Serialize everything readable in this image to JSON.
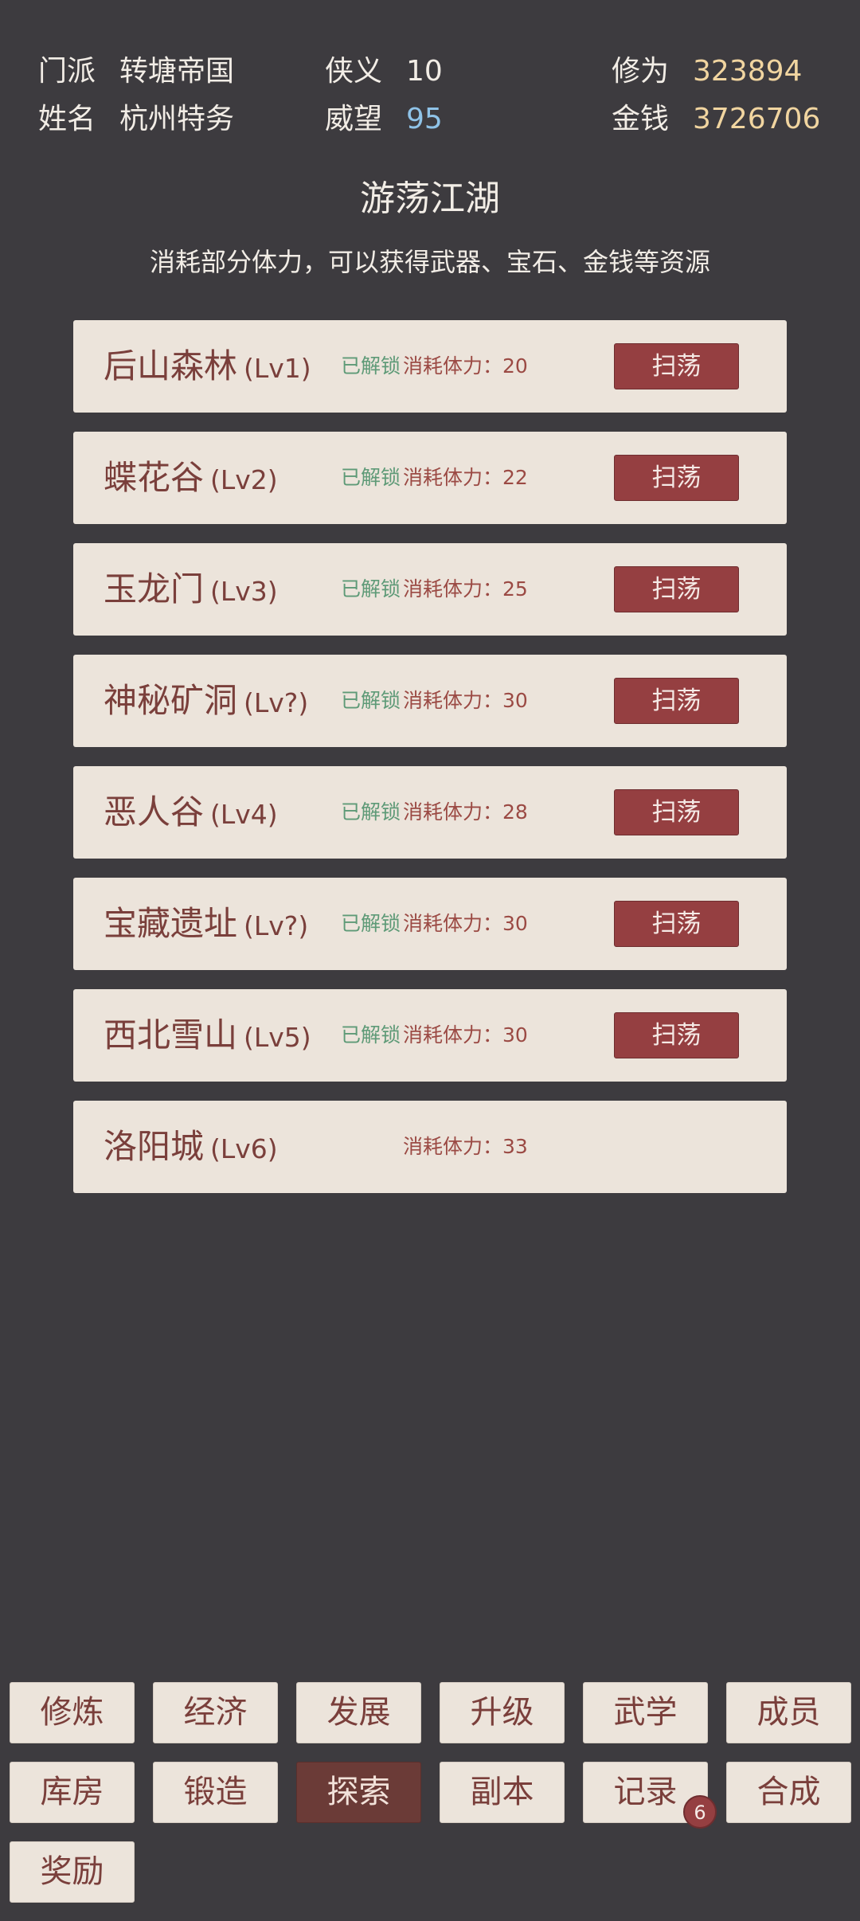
{
  "stats": {
    "sect_label": "门派",
    "sect_value": "转塘帝国",
    "name_label": "姓名",
    "name_value": "杭州特务",
    "chivalry_label": "侠义",
    "chivalry_value": "10",
    "prestige_label": "威望",
    "prestige_value": "95",
    "cultivation_label": "修为",
    "cultivation_value": "323894",
    "money_label": "金钱",
    "money_value": "3726706"
  },
  "colors": {
    "background": "#3d3b3f",
    "card": "#ece4db",
    "accent": "#953f41",
    "unlocked": "#5e9a77",
    "prestige": "#8fc3e8",
    "cultivation": "#f1d5a0"
  },
  "page": {
    "title": "游荡江湖",
    "description": "消耗部分体力，可以获得武器、宝石、金钱等资源"
  },
  "areas": [
    {
      "name": "后山森林",
      "level": "(Lv1)",
      "unlocked": "已解锁",
      "cost": "消耗体力：20",
      "button": "扫荡"
    },
    {
      "name": "蝶花谷",
      "level": "(Lv2)",
      "unlocked": "已解锁",
      "cost": "消耗体力：22",
      "button": "扫荡"
    },
    {
      "name": "玉龙门",
      "level": "(Lv3)",
      "unlocked": "已解锁",
      "cost": "消耗体力：25",
      "button": "扫荡"
    },
    {
      "name": "神秘矿洞",
      "level": "(Lv?)",
      "unlocked": "已解锁",
      "cost": "消耗体力：30",
      "button": "扫荡"
    },
    {
      "name": "恶人谷",
      "level": "(Lv4)",
      "unlocked": "已解锁",
      "cost": "消耗体力：28",
      "button": "扫荡"
    },
    {
      "name": "宝藏遗址",
      "level": "(Lv?)",
      "unlocked": "已解锁",
      "cost": "消耗体力：30",
      "button": "扫荡"
    },
    {
      "name": "西北雪山",
      "level": "(Lv5)",
      "unlocked": "已解锁",
      "cost": "消耗体力：30",
      "button": "扫荡"
    },
    {
      "name": "洛阳城",
      "level": "(Lv6)",
      "unlocked": "",
      "cost": "消耗体力：33",
      "button": ""
    }
  ],
  "nav": {
    "items": [
      {
        "label": "修炼",
        "active": false
      },
      {
        "label": "经济",
        "active": false
      },
      {
        "label": "发展",
        "active": false
      },
      {
        "label": "升级",
        "active": false
      },
      {
        "label": "武学",
        "active": false
      },
      {
        "label": "成员",
        "active": false
      },
      {
        "label": "库房",
        "active": false
      },
      {
        "label": "锻造",
        "active": false
      },
      {
        "label": "探索",
        "active": true
      },
      {
        "label": "副本",
        "active": false
      },
      {
        "label": "记录",
        "active": false,
        "badge": "6"
      },
      {
        "label": "合成",
        "active": false
      },
      {
        "label": "奖励",
        "active": false
      }
    ]
  }
}
